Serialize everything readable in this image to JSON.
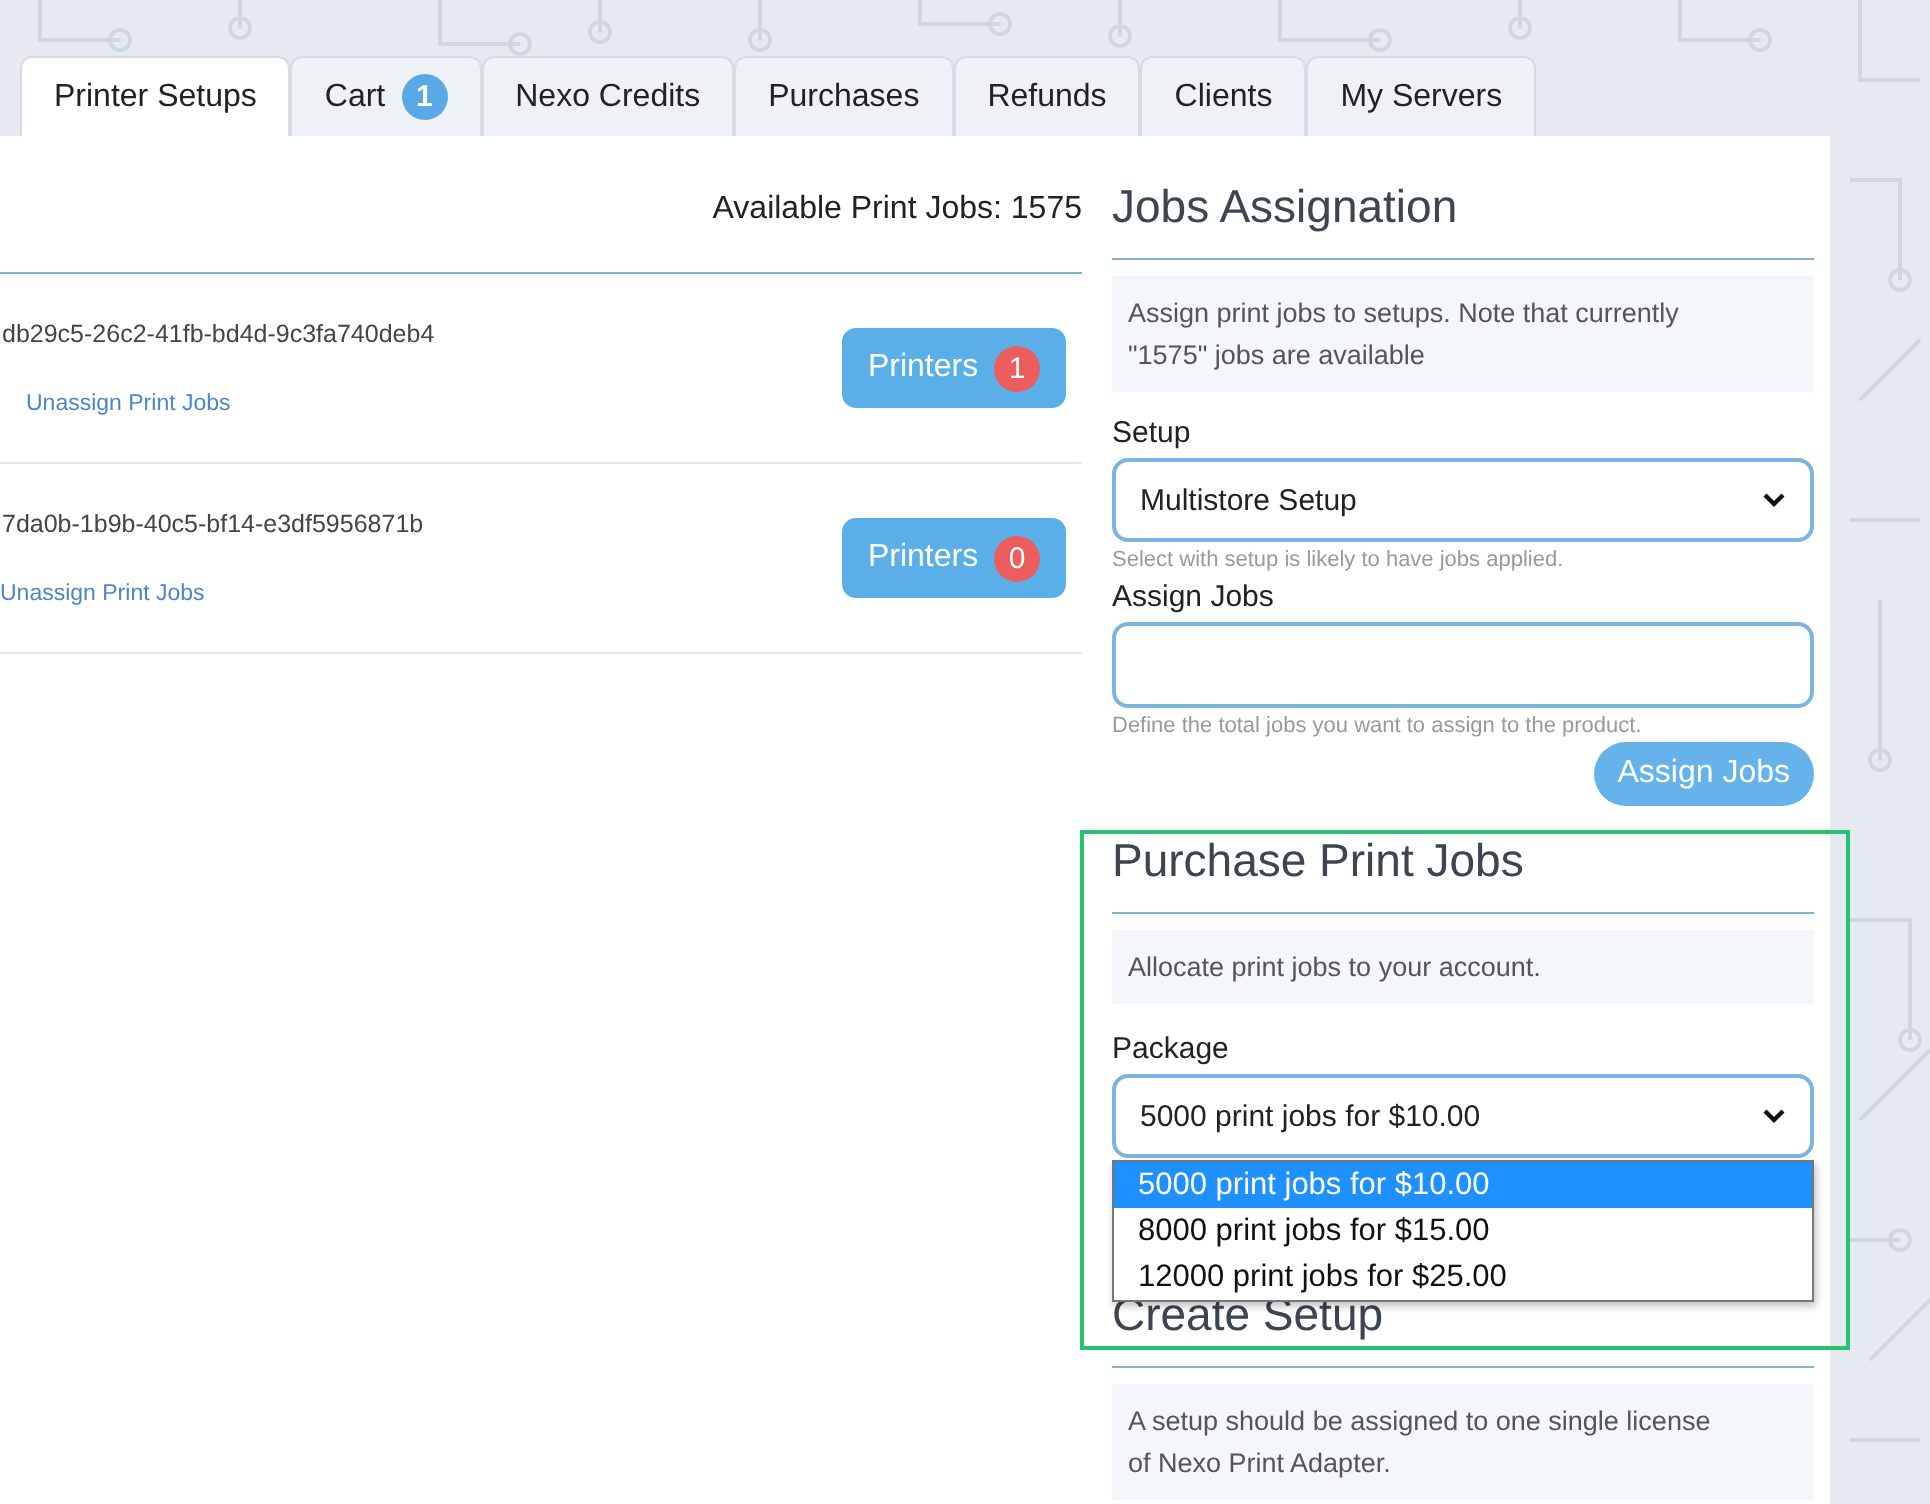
{
  "tabs": [
    {
      "label": "Printer Setups",
      "selected": true
    },
    {
      "label": "Cart",
      "selected": false,
      "badge": "1"
    },
    {
      "label": "Nexo Credits",
      "selected": false
    },
    {
      "label": "Purchases",
      "selected": false
    },
    {
      "label": "Refunds",
      "selected": false
    },
    {
      "label": "Clients",
      "selected": false
    },
    {
      "label": "My Servers",
      "selected": false
    }
  ],
  "available_jobs": "Available Print Jobs: 1575",
  "setups": [
    {
      "id": "db29c5-26c2-41fb-bd4d-9c3fa740deb4",
      "link": "Unassign Print Jobs",
      "button": "Printers",
      "count": "1"
    },
    {
      "id": "7da0b-1b9b-40c5-bf14-e3df5956871b",
      "link": "Unassign Print Jobs",
      "button": "Printers",
      "count": "0"
    }
  ],
  "jobs_assignation": {
    "title": "Jobs Assignation",
    "info": "Assign print jobs to setups. Note that currently \"1575\" jobs are available",
    "setup_label": "Setup",
    "setup_value": "Multistore Setup",
    "setup_help": "Select with setup is likely to have jobs applied.",
    "jobs_label": "Assign Jobs",
    "jobs_help": "Define the total jobs you want to assign to the product.",
    "button": "Assign Jobs"
  },
  "purchase": {
    "title": "Purchase Print Jobs",
    "info": "Allocate print jobs to your account.",
    "package_label": "Package",
    "package_value": "5000 print jobs for $10.00",
    "options": [
      {
        "label": "5000 print jobs for $10.00",
        "selected": true
      },
      {
        "label": "8000 print jobs for $15.00",
        "selected": false
      },
      {
        "label": "12000 print jobs for $25.00",
        "selected": false
      }
    ]
  },
  "create_setup": {
    "title": "Create Setup",
    "info": "A setup should be assigned to one single license of Nexo Print Adapter."
  }
}
